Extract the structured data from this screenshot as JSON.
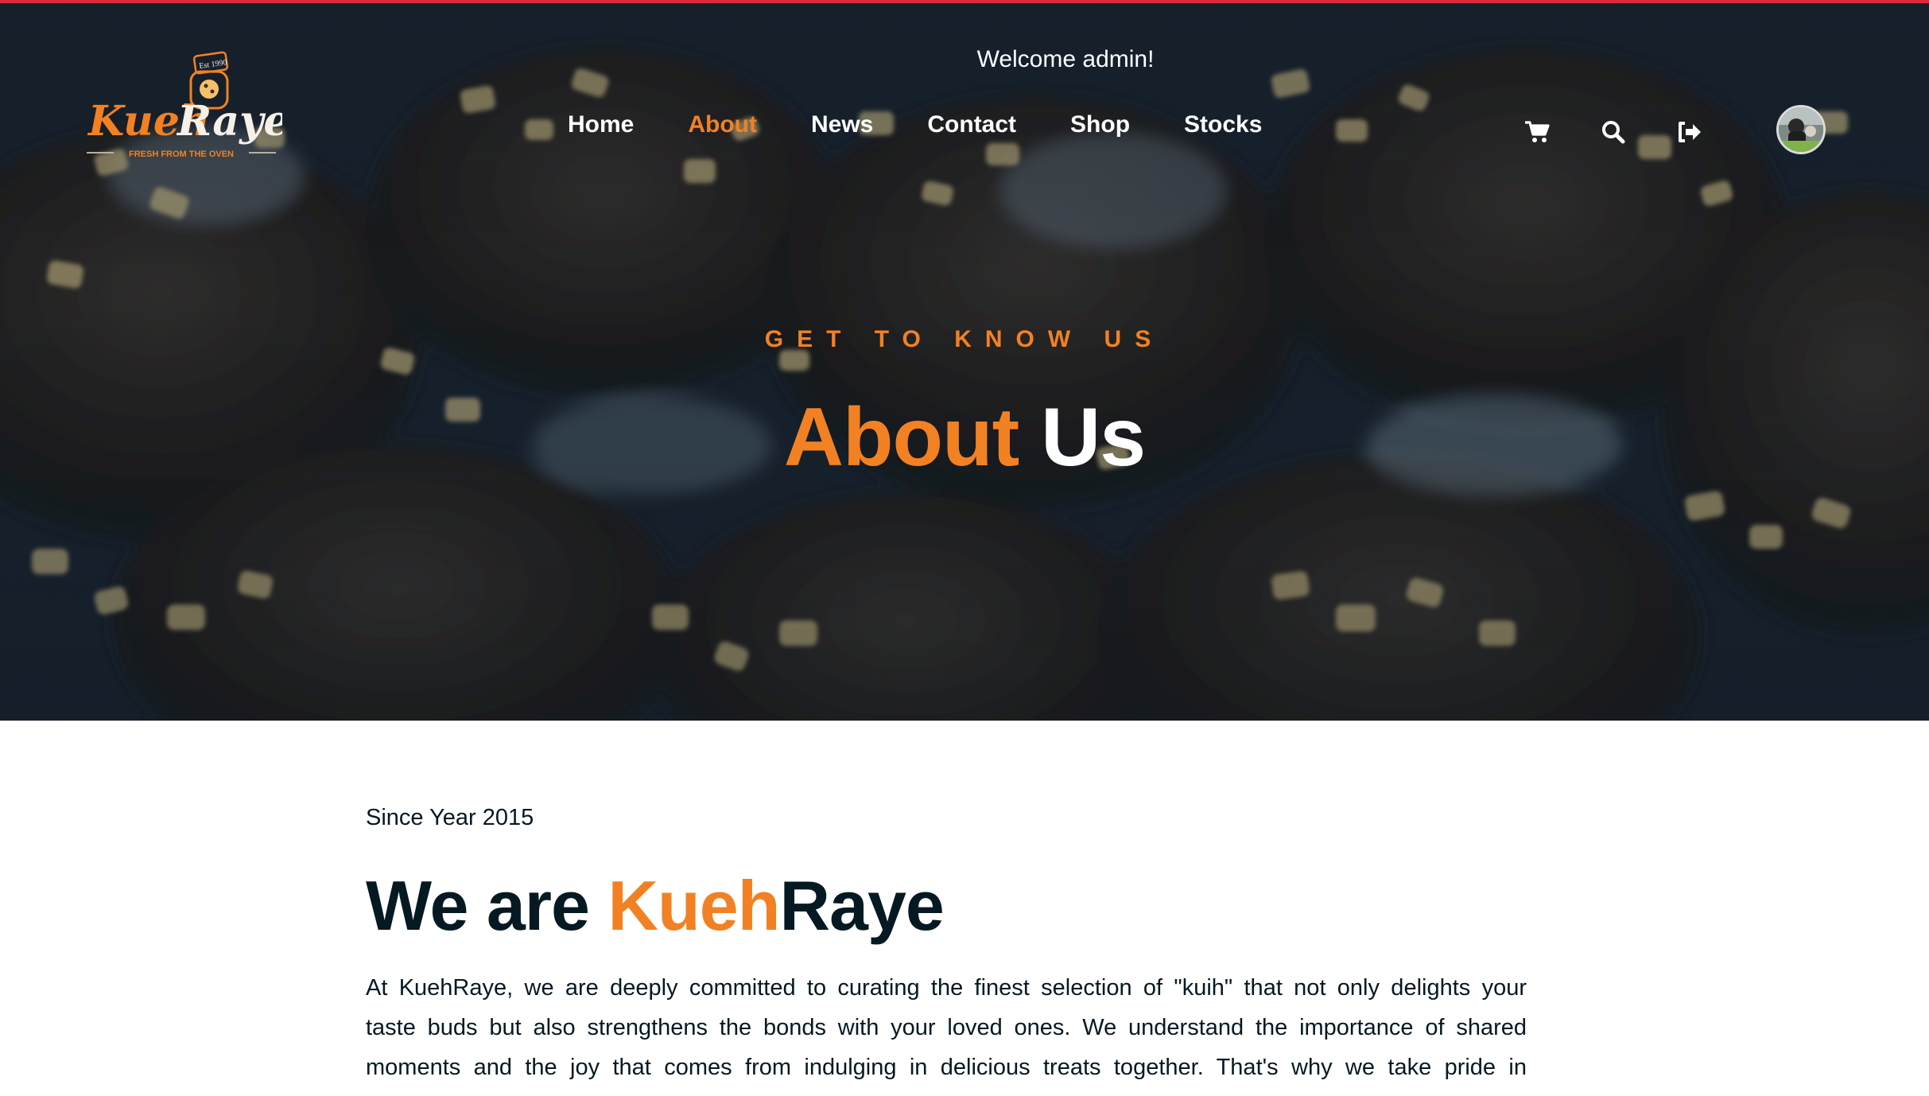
{
  "header": {
    "brand": {
      "name": "KuehRaye",
      "name_part1": "Kueh",
      "name_part2": "Raye",
      "tagline": "FRESH FROM THE OVEN",
      "badge": "Est. 1990"
    },
    "welcome": "Welcome admin!",
    "nav": [
      {
        "label": "Home",
        "active": false
      },
      {
        "label": "About",
        "active": true
      },
      {
        "label": "News",
        "active": false
      },
      {
        "label": "Contact",
        "active": false
      },
      {
        "label": "Shop",
        "active": false
      },
      {
        "label": "Stocks",
        "active": false
      }
    ],
    "icons": [
      "shopping-cart-icon",
      "search-icon",
      "sign-out-icon",
      "user-avatar"
    ]
  },
  "hero": {
    "eyebrow": "GET TO KNOW US",
    "title_highlight": "About",
    "title_rest": "Us"
  },
  "intro": {
    "since": "Since Year 2015",
    "headline_prefix": "We are",
    "headline_highlight": "Kueh",
    "headline_rest": "Raye",
    "paragraph_lines": [
      "At KuehRaye, we are deeply committed to curating the finest selection of \"kuih\" that not only delights your",
      "taste buds but also strengthens the bonds with your loved ones. We understand the importance of shared",
      "moments and the joy that comes from indulging in delicious treats together. That's why we take pride in"
    ]
  },
  "colors": {
    "accent": "#f28123",
    "dark": "#051922",
    "top_border": "#e0293a",
    "white": "#ffffff"
  }
}
